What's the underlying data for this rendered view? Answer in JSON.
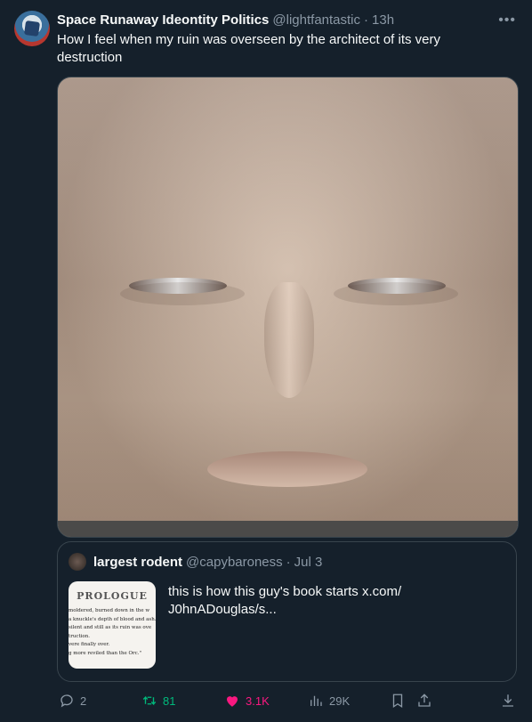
{
  "tweet": {
    "display_name": "Space Runaway Ideontity Politics",
    "handle": "@lightfantastic",
    "separator": "·",
    "time": "13h",
    "text": "How I feel when my ruin was overseen by the architect of its very destruction",
    "more_icon": "more-icon"
  },
  "quote": {
    "display_name": "largest rodent",
    "handle": "@capybaroness",
    "separator": "·",
    "date": "Jul 3",
    "text": "this is how this guy's book starts  x.com/ J0hnADouglas/s...",
    "thumb": {
      "title": "PROLOGUE",
      "lines": [
        "moldered, burned down in the w",
        "a knuckle's depth of blood and ash.",
        "silent and still as its ruin was ove",
        "truction.",
        "vere finally over.",
        "g more reviled than the Orc.\""
      ]
    }
  },
  "actions": {
    "replies": "2",
    "retweets": "81",
    "likes": "3.1K",
    "views": "29K"
  },
  "colors": {
    "background": "#15202b",
    "muted": "#8b98a5",
    "retweet": "#00ba7c",
    "like": "#f91880"
  }
}
